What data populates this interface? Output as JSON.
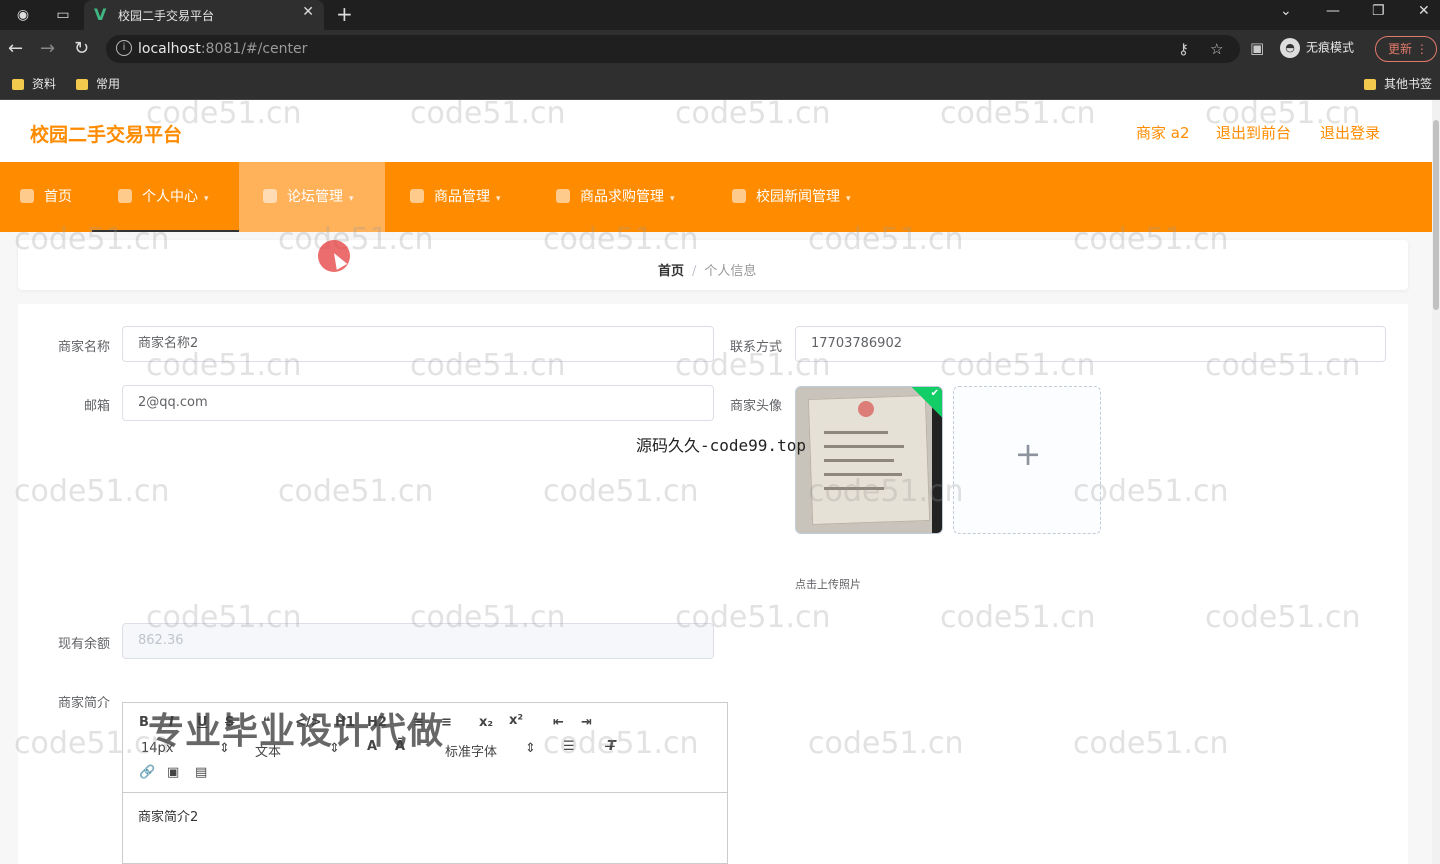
{
  "browser": {
    "tab_title": "校园二手交易平台",
    "url_host": "localhost",
    "url_rest": ":8081/#/center",
    "incognito_label": "无痕模式",
    "update_label": "更新",
    "bookmarks": [
      "资料",
      "常用"
    ],
    "other_bookmarks": "其他书签"
  },
  "header": {
    "site_title": "校园二手交易平台",
    "user_label": "商家 a2",
    "back_frontend": "退出到前台",
    "logout": "退出登录"
  },
  "nav": {
    "items": [
      {
        "label": "首页",
        "icon": "home-icon"
      },
      {
        "label": "个人中心",
        "icon": "user-icon"
      },
      {
        "label": "论坛管理",
        "icon": "forum-icon"
      },
      {
        "label": "商品管理",
        "icon": "goods-icon"
      },
      {
        "label": "商品求购管理",
        "icon": "request-icon"
      },
      {
        "label": "校园新闻管理",
        "icon": "news-icon"
      }
    ]
  },
  "breadcrumb": {
    "home": "首页",
    "separator": "/",
    "current": "个人信息"
  },
  "form": {
    "merchant_name_label": "商家名称",
    "merchant_name_value": "商家名称2",
    "contact_label": "联系方式",
    "contact_value": "17703786902",
    "email_label": "邮箱",
    "email_value": "2@qq.com",
    "avatar_label": "商家头像",
    "upload_tip": "点击上传照片",
    "balance_label": "现有余额",
    "balance_value": "862.36",
    "intro_label": "商家简介",
    "intro_value": "商家简介2"
  },
  "editor_toolbar": {
    "row1": [
      "B",
      "I",
      "U",
      "S",
      "❝",
      "</>",
      "H1",
      "H2",
      "≡",
      "≡",
      "x₂",
      "x²",
      "⇤",
      "⇥"
    ],
    "font_size": "14px",
    "text_type": "文本",
    "font_family": "标准字体"
  },
  "overlays": {
    "watermark": "code51.cn",
    "center_text": "源码久久-code99.top",
    "promo_text": "专业毕业设计代做"
  },
  "colors": {
    "brand": "#ff8c00",
    "upload_success": "#13ce66"
  }
}
